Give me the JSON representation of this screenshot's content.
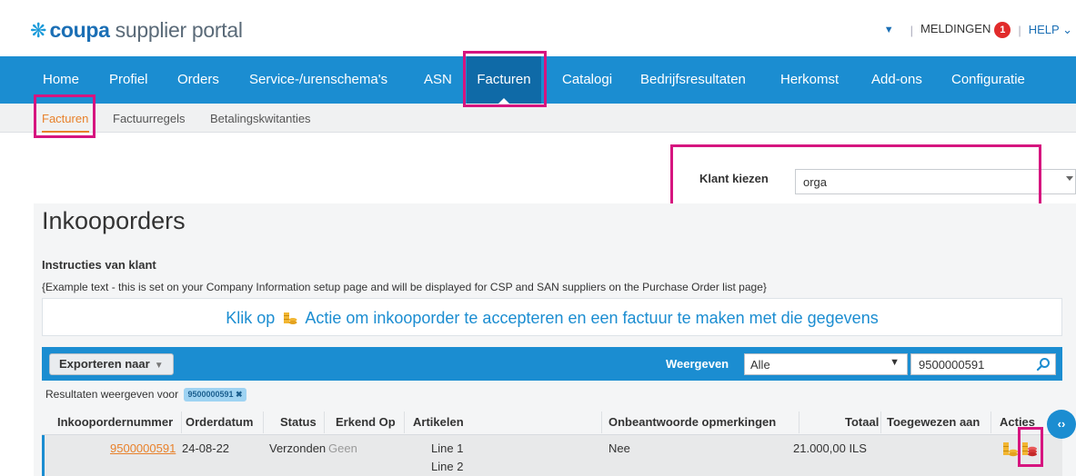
{
  "header": {
    "logo_brand": "coupa",
    "logo_product": "supplier portal",
    "notifications_label": "MELDINGEN",
    "notifications_count": "1",
    "help_label": "HELP",
    "help_chevron": "⌄"
  },
  "mainnav": {
    "items": [
      {
        "label": "Home"
      },
      {
        "label": "Profiel"
      },
      {
        "label": "Orders"
      },
      {
        "label": "Service-/urenschema's"
      },
      {
        "label": "ASN"
      },
      {
        "label": "Facturen"
      },
      {
        "label": "Catalogi"
      },
      {
        "label": "Bedrijfsresultaten"
      },
      {
        "label": "Herkomst"
      },
      {
        "label": "Add-ons"
      },
      {
        "label": "Configuratie"
      }
    ],
    "active": "Facturen"
  },
  "subnav": {
    "items": [
      {
        "label": "Facturen"
      },
      {
        "label": "Factuurregels"
      },
      {
        "label": "Betalingskwitanties"
      }
    ],
    "active": "Facturen"
  },
  "customer": {
    "label": "Klant kiezen",
    "value": "orga"
  },
  "page": {
    "title": "Inkooporders",
    "instructions_title": "Instructies van klant",
    "instructions_text": "{Example text - this is set on your Company Information setup page and will be displayed for CSP and SAN suppliers on the Purchase Order list page}",
    "banner_before": "Klik op",
    "banner_after": "Actie om inkooporder te accepteren en een factuur te maken met die gegevens"
  },
  "toolbar": {
    "export_label": "Exporteren naar",
    "view_label": "Weergeven",
    "view_value": "Alle",
    "search_value": "9500000591"
  },
  "results": {
    "label": "Resultaten weergeven voor",
    "chip": "9500000591 ✖"
  },
  "table": {
    "columns": [
      "Inkoopordernummer",
      "Orderdatum",
      "Status",
      "Erkend Op",
      "Artikelen",
      "Onbeantwoorde opmerkingen",
      "Totaal",
      "Toegewezen aan",
      "Acties"
    ],
    "rows": [
      {
        "po_number": "9500000591",
        "order_date": "24-08-22",
        "status": "Verzonden",
        "acknowledged": "Geen",
        "items": [
          "Line 1",
          "Line 2"
        ],
        "unanswered_comments": "Nee",
        "total": "21.000,00 ILS",
        "assigned_to": ""
      }
    ]
  },
  "colors": {
    "nav_blue": "#1b8dd1",
    "nav_active": "#0f6aa7",
    "accent_orange": "#e8812b",
    "highlight_magenta": "#d6157f"
  },
  "icons": {
    "logo": "coupa-flower-icon",
    "search": "search-icon",
    "flip_po": "coins-icon",
    "invoice": "coins-red-icon",
    "side_toggle": "chevron-code-icon"
  }
}
